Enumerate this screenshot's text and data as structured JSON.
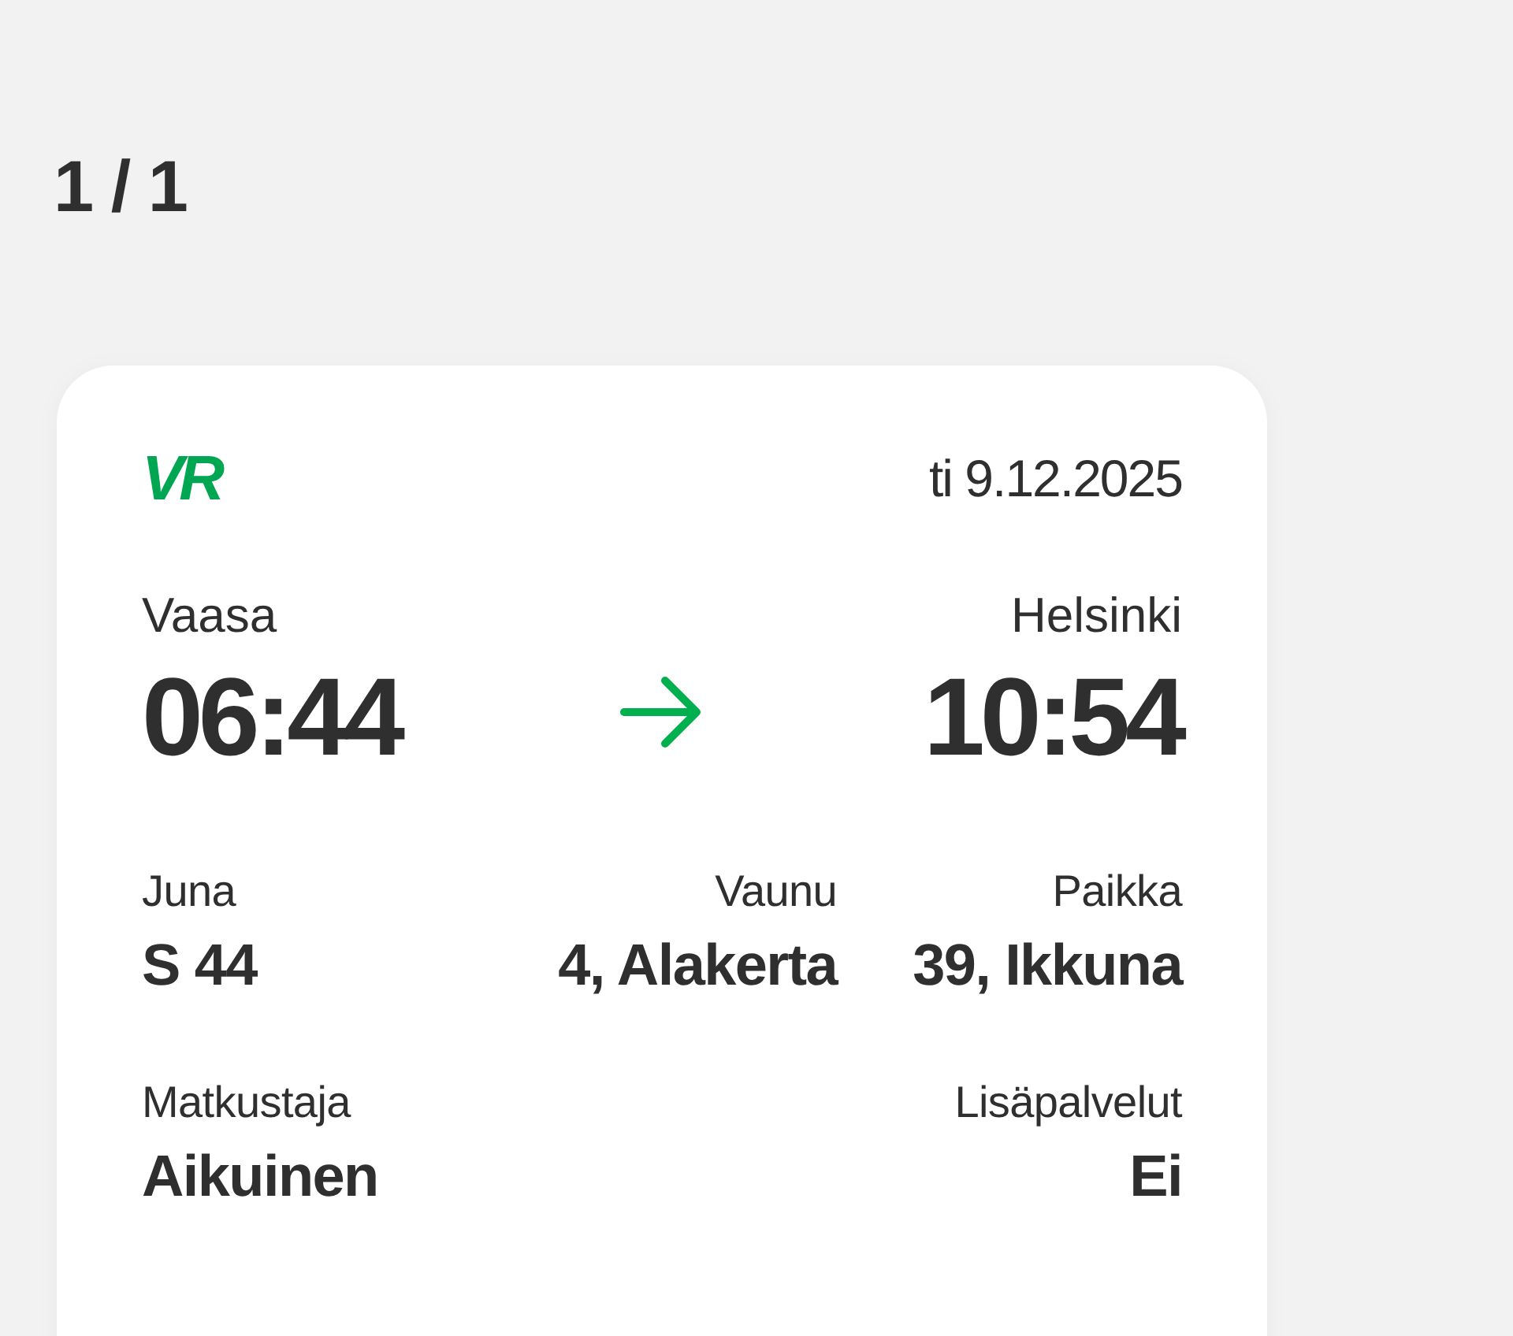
{
  "page_counter": "1 / 1",
  "ticket": {
    "logo": "VR",
    "date": "ti 9.12.2025",
    "departure": {
      "station": "Vaasa",
      "time": "06:44"
    },
    "arrival": {
      "station": "Helsinki",
      "time": "10:54"
    },
    "detail_rows": [
      [
        {
          "label": "Juna",
          "value": "S 44"
        },
        {
          "label": "Vaunu",
          "value": "4, Alakerta"
        },
        {
          "label": "Paikka",
          "value": "39, Ikkuna"
        }
      ],
      [
        {
          "label": "Matkustaja",
          "value": "Aikuinen"
        },
        {
          "label": "Lisäpalvelut",
          "value": "Ei"
        }
      ]
    ]
  }
}
